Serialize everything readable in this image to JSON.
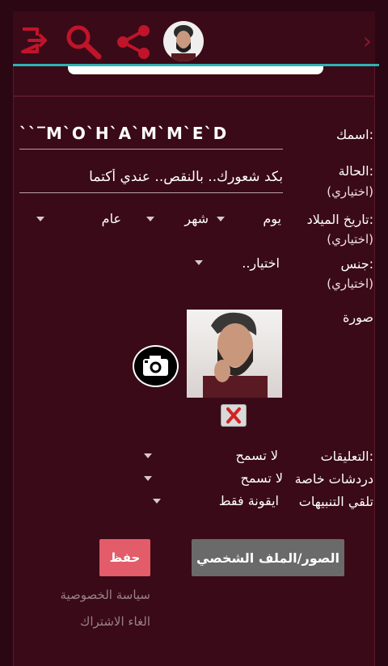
{
  "toolbar": {
    "icons": [
      "logout-icon",
      "search-icon",
      "share-icon"
    ],
    "nav_next": "›"
  },
  "form": {
    "name_label": "اسمك:",
    "name_value": "``‾M`O`H`A`M`M`E`D",
    "status_label": "الحالة:",
    "status_optional": "(اختياري)",
    "status_value": "بكد شعورك.. بالنقص.. عندي أكتما",
    "birth_label": "تاريخ الميلاد:",
    "birth_optional": "(اختياري)",
    "birth_day": "يوم",
    "birth_month": "شهر",
    "birth_year": "عام",
    "gender_label": "جنس:",
    "gender_optional": "(اختياري)",
    "gender_value": "اختيار..",
    "photo_label": "صورة",
    "comments_label": "التعليقات:",
    "comments_value": "لا تسمح",
    "private_label": "دردشات خاصة",
    "private_value": "لا تسمح",
    "notify_label": "تلقي التنبيهات",
    "notify_value": "ايقونة فقط"
  },
  "actions": {
    "profile_label": "الصور/الملف الشخصي",
    "save_label": "حفظ"
  },
  "links": {
    "privacy": "سياسة الخصوصية",
    "unsubscribe": "الغاء الاشتراك"
  },
  "colors": {
    "background": "#3a0a18",
    "accent_red": "#c0142a",
    "teal": "#2fb3b3",
    "save": "#e25c6a"
  }
}
